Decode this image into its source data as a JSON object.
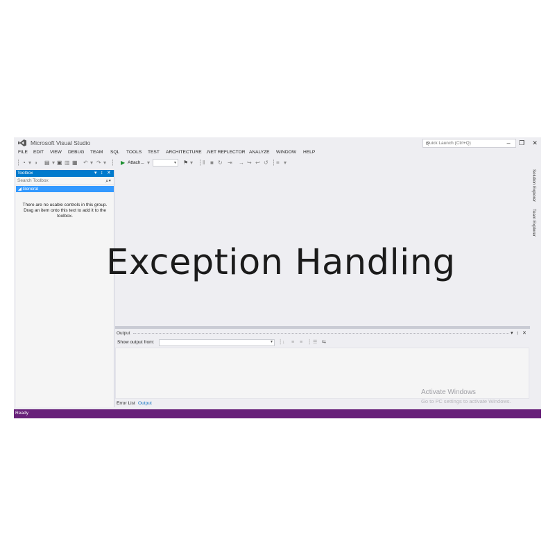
{
  "window": {
    "title": "Microsoft Visual Studio",
    "quick_launch_placeholder": "Quick Launch (Ctrl+Q)",
    "brand_color": "#68217a",
    "accent_color": "#007acc"
  },
  "menu": [
    "FILE",
    "EDIT",
    "VIEW",
    "DEBUG",
    "TEAM",
    "SQL",
    "TOOLS",
    "TEST",
    "ARCHITECTURE",
    ".NET REFLECTOR",
    "ANALYZE",
    "WINDOW",
    "HELP"
  ],
  "toolbar": {
    "attach_label": "Attach..."
  },
  "toolbox": {
    "title": "Toolbox",
    "search_placeholder": "Search Toolbox",
    "group_label": "◢ General",
    "empty_message": "There are no usable controls in this group. Drag an item onto this text to add it to the toolbox."
  },
  "side_tabs": [
    "Solution Explorer",
    "Team Explorer"
  ],
  "output": {
    "title": "Output",
    "show_output_label": "Show output from:",
    "tabs": [
      "Error List",
      "Output"
    ],
    "active_tab": "Output"
  },
  "watermark": {
    "line1": "Activate Windows",
    "line2": "Go to PC settings to activate Windows."
  },
  "status": {
    "text": "Ready"
  },
  "overlay": {
    "title": "Exception Handling"
  }
}
